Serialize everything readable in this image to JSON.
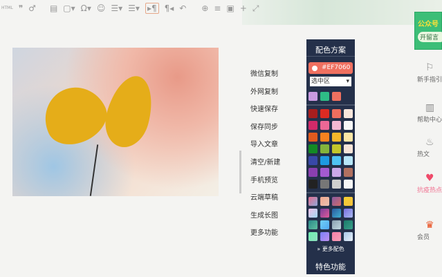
{
  "toolbar": {
    "items": [
      "HTML",
      "quote-icon",
      "link-icon",
      "format-painter-icon",
      "image-icon",
      "omega-icon",
      "emoji-icon",
      "ordered-list-icon",
      "unordered-list-icon",
      "ltr-icon",
      "rtl-icon",
      "undo-icon",
      "zoom-icon",
      "align-icon",
      "preview-icon",
      "plus-icon",
      "fullscreen-icon"
    ],
    "html_label": "HTML"
  },
  "menu": [
    "微信复制",
    "外网复制",
    "快速保存",
    "保存同步",
    "导入文章",
    "清空/新建",
    "手机预览",
    "云端草稿",
    "生成长图",
    "更多功能"
  ],
  "palette": {
    "title": "配色方案",
    "hex": "#EF7060",
    "select": "选中区",
    "recent": [
      "#c99ae0",
      "#2ebd86",
      "#ef7060"
    ],
    "solid": [
      "#a81e1e",
      "#dd2b22",
      "#ee6e5e",
      "#f8e6dc",
      "#d22a69",
      "#ec6896",
      "#f3b8d2",
      "#f7f7f7",
      "#e05a1e",
      "#f6821f",
      "#f4b72a",
      "#fbe6a6",
      "#138a24",
      "#84b43c",
      "#c4c62a",
      "#f7e4d8",
      "#3848a8",
      "#1e9ae2",
      "#4fc2f4",
      "#b7e6f8",
      "#8a3fb0",
      "#a45ad0",
      "#caa8ea",
      "#b07060",
      "#222222",
      "#777777",
      "#cfcfcf",
      "#f7f7f7"
    ],
    "gradients": [
      [
        "#e46e8e",
        "#8fa7d8"
      ],
      [
        "#f0a890",
        "#e9c0b0"
      ],
      [
        "#8a5aa0",
        "#d06a6a"
      ],
      [
        "#f8d030",
        "#f2c040"
      ],
      [
        "#f0c0e8",
        "#a0d8f0"
      ],
      [
        "#7a3e9a",
        "#e05a9a"
      ],
      [
        "#2a5aa0",
        "#40b0d0"
      ],
      [
        "#7a70e0",
        "#a8b8f0"
      ],
      [
        "#2a8a8a",
        "#60c0a0"
      ],
      [
        "#70d0f8",
        "#50a8f0"
      ],
      [
        "#8aa0b0",
        "#c0d8e0"
      ],
      [
        "#1a7a6a",
        "#3aa08a"
      ],
      [
        "#6ef0b0",
        "#90e0c0"
      ],
      [
        "#7a80f8",
        "#c090f0"
      ],
      [
        "#f880a8",
        "#f8a0b8"
      ],
      [
        "#a8c8e8",
        "#e8f0f8"
      ]
    ],
    "more": "更多配色",
    "feature": "特色功能"
  },
  "sidebar": {
    "banner_title": "公众号",
    "banner_button": "开留言",
    "items": [
      {
        "label": "新手指引",
        "icon": "guide-icon"
      },
      {
        "label": "帮助中心",
        "icon": "book-icon"
      },
      {
        "label": "热文",
        "icon": "flame-icon"
      },
      {
        "label": "抗疫热点",
        "icon": "heart-hands-icon"
      },
      {
        "label": "会员",
        "icon": "crown-icon"
      }
    ]
  }
}
